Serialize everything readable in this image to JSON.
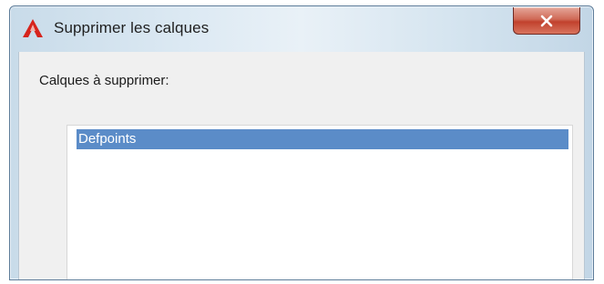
{
  "window": {
    "title": "Supprimer les calques",
    "app_icon": "autocad-red-a-icon",
    "close_icon": "close-icon"
  },
  "content": {
    "list_label": "Calques à supprimer:",
    "layers": [
      {
        "name": "Defpoints",
        "selected": true
      }
    ]
  },
  "colors": {
    "selection_bg": "#5b8cc8",
    "selection_text": "#ffffff",
    "close_button": "#c8483a",
    "app_icon": "#d6241c"
  }
}
